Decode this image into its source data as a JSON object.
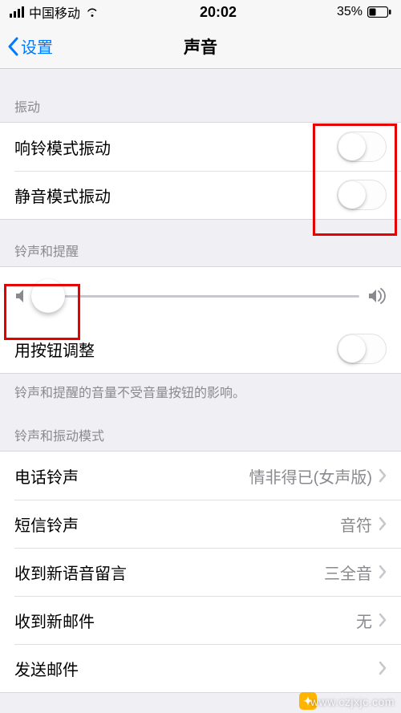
{
  "status": {
    "carrier": "中国移动",
    "time": "20:02",
    "battery": "35%"
  },
  "nav": {
    "back": "设置",
    "title": "声音"
  },
  "sections": {
    "vibration": {
      "header": "振动",
      "ring_vibrate": "响铃模式振动",
      "silent_vibrate": "静音模式振动"
    },
    "ringer": {
      "header": "铃声和提醒",
      "change_with_buttons": "用按钮调整",
      "footer": "铃声和提醒的音量不受音量按钮的影响。"
    },
    "patterns": {
      "header": "铃声和振动模式",
      "ringtone": {
        "label": "电话铃声",
        "value": "情非得已(女声版)"
      },
      "texttone": {
        "label": "短信铃声",
        "value": "音符"
      },
      "voicemail": {
        "label": "收到新语音留言",
        "value": "三全音"
      },
      "newmail": {
        "label": "收到新邮件",
        "value": "无"
      },
      "sentmail": {
        "label": "发送邮件",
        "value": ""
      }
    }
  },
  "watermark": "www.czjxjc.com",
  "icons": {
    "back": "chevron-left-icon",
    "chevron": "chevron-right-icon",
    "wifi": "wifi-icon",
    "battery": "battery-icon",
    "vol_low": "volume-low-icon",
    "vol_high": "volume-high-icon"
  },
  "colors": {
    "accent": "#007aff",
    "highlight": "#e60000"
  }
}
